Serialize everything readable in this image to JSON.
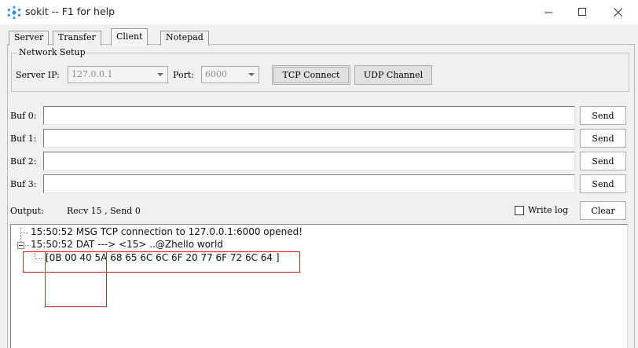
{
  "window": {
    "title": "sokit -- F1 for help",
    "icon": "gear-cluster-icon",
    "controls": [
      "minimize-icon",
      "maximize-icon",
      "close-icon"
    ]
  },
  "tabs": [
    {
      "label": "Server",
      "active": false
    },
    {
      "label": "Transfer",
      "active": false
    },
    {
      "label": "Client",
      "active": true
    },
    {
      "label": "Notepad",
      "active": false
    }
  ],
  "network_setup": {
    "group_label": "Network Setup",
    "server_ip_label": "Server IP:",
    "server_ip_value": "127.0.0.1",
    "port_label": "Port:",
    "port_value": "6000",
    "tcp_button": "TCP Connect",
    "udp_button": "UDP Channel"
  },
  "buffers": [
    {
      "label": "Buf 0:",
      "value": "",
      "send_label": "Send"
    },
    {
      "label": "Buf 1:",
      "value": "",
      "send_label": "Send"
    },
    {
      "label": "Buf 2:",
      "value": "",
      "send_label": "Send"
    },
    {
      "label": "Buf 3:",
      "value": "",
      "send_label": "Send"
    }
  ],
  "output_bar": {
    "label": "Output:",
    "stats": "Recv 15 , Send 0",
    "write_log_label": "Write log",
    "write_log_checked": false,
    "clear_label": "Clear"
  },
  "log": {
    "line1": "15:50:52 MSG TCP connection to 127.0.0.1:6000 opened!",
    "line2": "15:50:52 DAT ---> <15> ..@Zhello world",
    "line3": "[0B 00 40 5A 68 65 6C 6C 6F 20 77 6F 72 6C 64 ]"
  },
  "colors": {
    "window_bg": "#f0f0f0",
    "annotation_red": "#e21a1a",
    "icon_blue": "#3a8fd8"
  }
}
